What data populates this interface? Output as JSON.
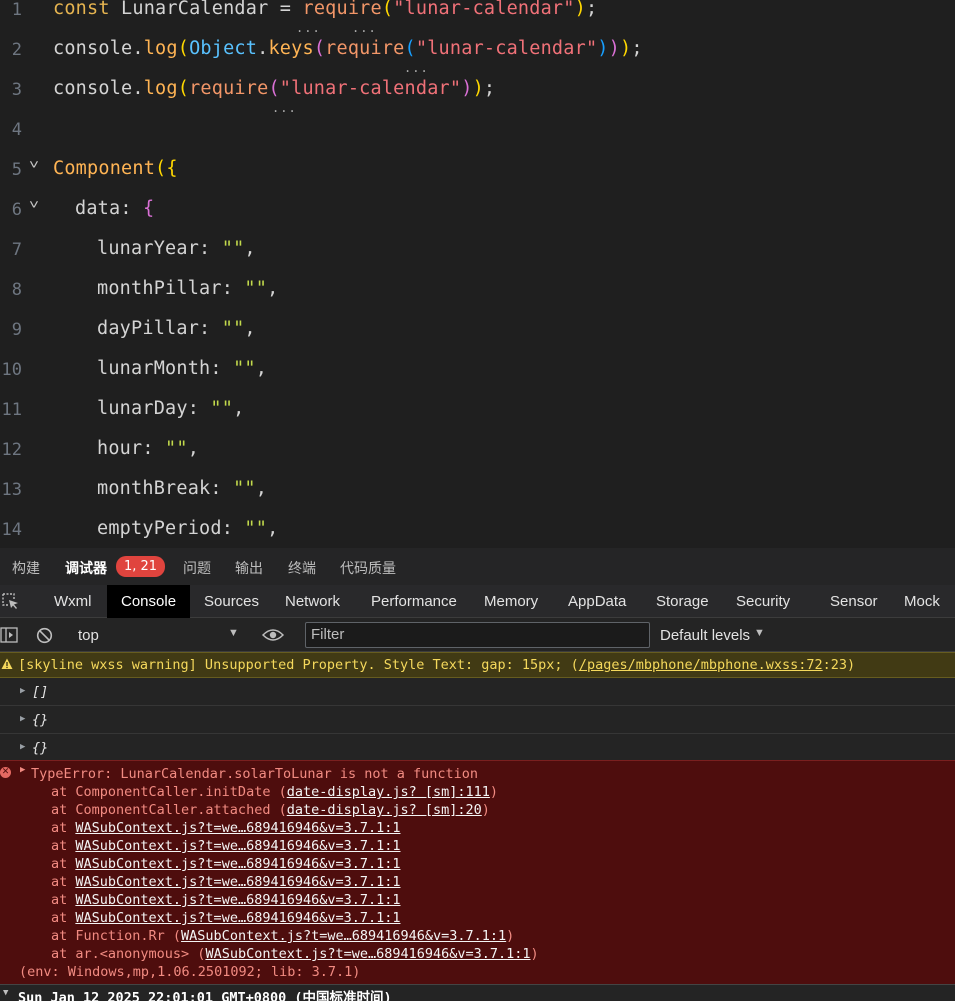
{
  "editor": {
    "lines": [
      {
        "num": "1"
      },
      {
        "num": "2"
      },
      {
        "num": "3"
      },
      {
        "num": "4"
      },
      {
        "num": "5"
      },
      {
        "num": "6"
      },
      {
        "num": "7"
      },
      {
        "num": "8"
      },
      {
        "num": "9"
      },
      {
        "num": "10"
      },
      {
        "num": "11"
      },
      {
        "num": "12"
      },
      {
        "num": "13"
      },
      {
        "num": "14"
      }
    ],
    "tokens": {
      "const": "const",
      "lunar_calendar_var": "LunarCalendar",
      "eq": "=",
      "require": "require",
      "open_paren": "(",
      "module_str": "\"lunar-calendar\"",
      "close_semi": ");",
      "console": "console",
      "dot": ".",
      "log": "log",
      "object": "Object",
      "keys": "keys",
      "close3": ")));",
      "close2": "));",
      "component": "Component",
      "component_open": "({",
      "data": "data",
      "colon_brace": ": {",
      "empty_str": "\"\"",
      "comma": ",",
      "props": [
        "lunarYear",
        "monthPillar",
        "dayPillar",
        "lunarMonth",
        "lunarDay",
        "hour",
        "monthBreak",
        "emptyPeriod"
      ]
    },
    "ellipsis": "..."
  },
  "panel_tabs": {
    "build": "构建",
    "debugger": "调试器",
    "badge": "1, 21",
    "issues": "问题",
    "output": "输出",
    "terminal": "终端",
    "code_quality": "代码质量"
  },
  "devtools_tabs": {
    "wxml": "Wxml",
    "console": "Console",
    "sources": "Sources",
    "network": "Network",
    "performance": "Performance",
    "memory": "Memory",
    "appdata": "AppData",
    "storage": "Storage",
    "security": "Security",
    "sensor": "Sensor",
    "mock": "Mock"
  },
  "toolbar": {
    "context": "top",
    "filter_placeholder": "Filter",
    "levels": "Default levels"
  },
  "console": {
    "warning": {
      "prefix": "[skyline wxss warning] Unsupported Property. Style Text: gap: 15px; (",
      "link": "/pages/mbphone/mbphone.wxss:72",
      "suffix": ":23)"
    },
    "logs": [
      "[]",
      "{}",
      "{}"
    ],
    "error": {
      "title": "TypeError: LunarCalendar.solarToLunar is not a function",
      "frames": [
        {
          "prefix": "at ComponentCaller.initDate (",
          "link": "date-display.js? [sm]:111",
          "suffix": ")"
        },
        {
          "prefix": "at ComponentCaller.attached (",
          "link": "date-display.js? [sm]:20",
          "suffix": ")"
        },
        {
          "prefix": "at ",
          "link": "WASubContext.js?t=we…689416946&v=3.7.1:1",
          "suffix": ""
        },
        {
          "prefix": "at ",
          "link": "WASubContext.js?t=we…689416946&v=3.7.1:1",
          "suffix": ""
        },
        {
          "prefix": "at ",
          "link": "WASubContext.js?t=we…689416946&v=3.7.1:1",
          "suffix": ""
        },
        {
          "prefix": "at ",
          "link": "WASubContext.js?t=we…689416946&v=3.7.1:1",
          "suffix": ""
        },
        {
          "prefix": "at ",
          "link": "WASubContext.js?t=we…689416946&v=3.7.1:1",
          "suffix": ""
        },
        {
          "prefix": "at ",
          "link": "WASubContext.js?t=we…689416946&v=3.7.1:1",
          "suffix": ""
        },
        {
          "prefix": "at Function.Rr (",
          "link": "WASubContext.js?t=we…689416946&v=3.7.1:1",
          "suffix": ")"
        },
        {
          "prefix": "at ar.<anonymous> (",
          "link": "WASubContext.js?t=we…689416946&v=3.7.1:1",
          "suffix": ")"
        }
      ],
      "env": "(env: Windows,mp,1.06.2501092; lib: 3.7.1)"
    },
    "date_group": "Sun Jan 12 2025 22:01:01 GMT+0800 (中国标准时间)"
  },
  "colors": {
    "editor_bg": "#1f1f1f",
    "warning_bg": "#413a14",
    "error_bg": "#4e0d0d",
    "badge": "#e0443e"
  }
}
